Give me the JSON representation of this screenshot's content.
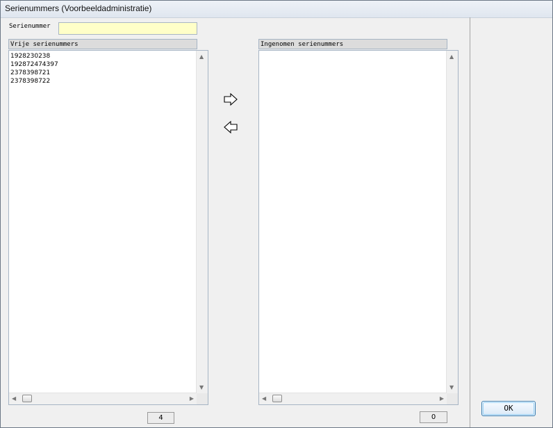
{
  "window": {
    "title": "Serienummers (Voorbeeldadministratie)"
  },
  "search": {
    "label": "Serienummer",
    "value": ""
  },
  "left_list": {
    "header": "Vrije serienummers",
    "items": [
      "1928230238",
      "192872474397",
      "2378398721",
      "2378398722"
    ],
    "count": "4"
  },
  "right_list": {
    "header": "Ingenomen serienummers",
    "items": [],
    "count": "0"
  },
  "buttons": {
    "move_right_icon": "arrow-right-icon",
    "move_left_icon": "arrow-left-icon",
    "ok_label": "OK"
  },
  "colors": {
    "input_bg": "#ffffc8",
    "ok_border": "#3c7fb1"
  }
}
